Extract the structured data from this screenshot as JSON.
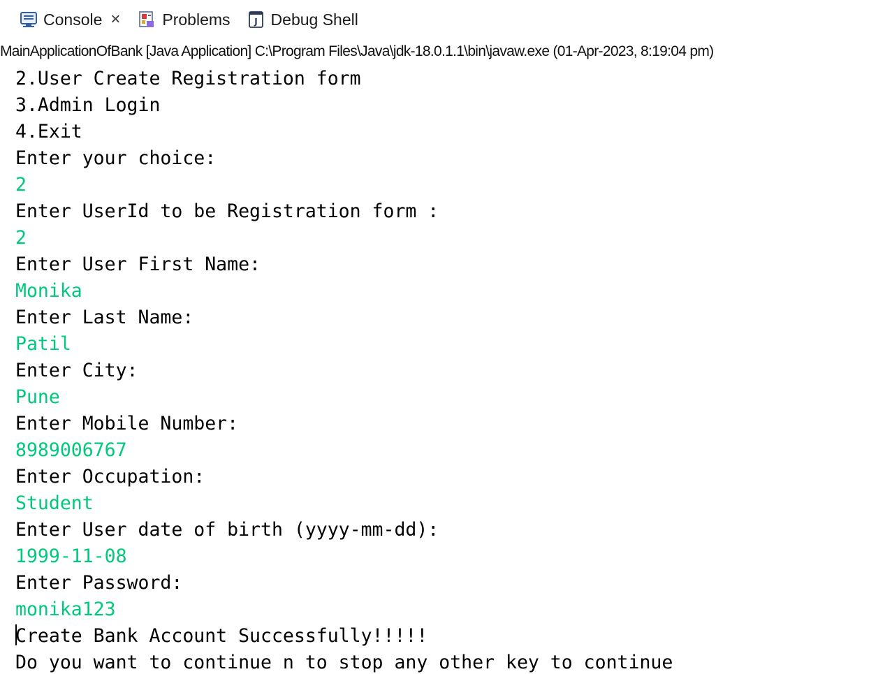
{
  "tabs": [
    {
      "label": "Console",
      "closable": true,
      "icon": "console-icon"
    },
    {
      "label": "Problems",
      "closable": false,
      "icon": "problems-icon"
    },
    {
      "label": "Debug Shell",
      "closable": false,
      "icon": "debug-shell-icon"
    }
  ],
  "launch_info": "MainApplicationOfBank [Java Application] C:\\Program Files\\Java\\jdk-18.0.1.1\\bin\\javaw.exe  (01-Apr-2023, 8:19:04 pm)",
  "colors": {
    "output": "#000000",
    "user_input": "#00c87d"
  },
  "console_lines": [
    {
      "text": "2.User Create Registration form",
      "kind": "out"
    },
    {
      "text": "3.Admin Login",
      "kind": "out"
    },
    {
      "text": "4.Exit",
      "kind": "out"
    },
    {
      "text": "Enter your choice:",
      "kind": "out"
    },
    {
      "text": "2",
      "kind": "in"
    },
    {
      "text": "Enter UserId to be Registration form :",
      "kind": "out"
    },
    {
      "text": "2",
      "kind": "in"
    },
    {
      "text": "Enter User First Name:",
      "kind": "out"
    },
    {
      "text": "Monika",
      "kind": "in"
    },
    {
      "text": "Enter Last Name:",
      "kind": "out"
    },
    {
      "text": "Patil",
      "kind": "in"
    },
    {
      "text": "Enter City:",
      "kind": "out"
    },
    {
      "text": "Pune",
      "kind": "in"
    },
    {
      "text": "Enter Mobile Number:",
      "kind": "out"
    },
    {
      "text": "8989006767",
      "kind": "in"
    },
    {
      "text": "Enter Occupation:",
      "kind": "out"
    },
    {
      "text": "Student",
      "kind": "in"
    },
    {
      "text": "Enter User date of birth (yyyy-mm-dd):",
      "kind": "out"
    },
    {
      "text": "1999-11-08",
      "kind": "in"
    },
    {
      "text": "Enter Password:",
      "kind": "out"
    },
    {
      "text": "monika123",
      "kind": "in"
    },
    {
      "text": "Create Bank Account Successfully!!!!!",
      "kind": "out",
      "caret": true
    },
    {
      "text": "Do you want to continue n to stop any other key to continue",
      "kind": "out"
    }
  ]
}
